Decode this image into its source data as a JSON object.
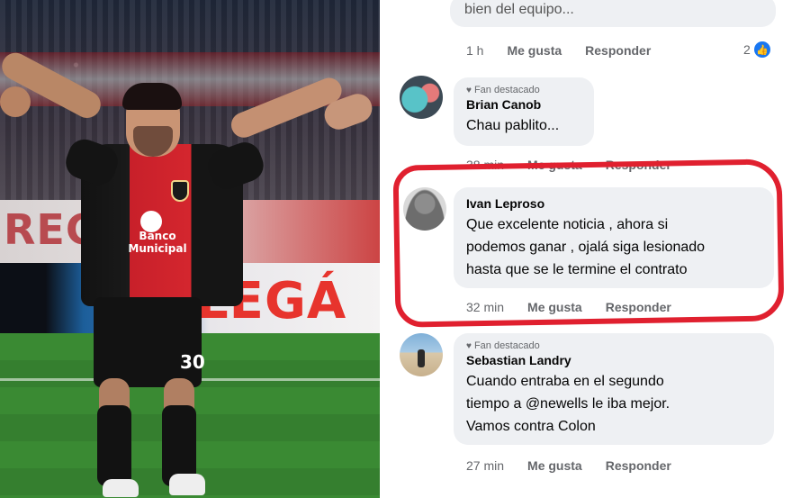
{
  "photo": {
    "banner_text": "RECHO",
    "adboard_text": "LEGÁ",
    "shirt_sponsor": "Banco Municipal",
    "shirt_number": "30"
  },
  "comments": [
    {
      "id": "top-partial",
      "text_partial": "bien del equipo...",
      "time": "1 h",
      "like_label": "Me gusta",
      "reply_label": "Responder",
      "reaction_count": "2"
    },
    {
      "id": "brian",
      "badge": "Fan destacado",
      "name": "Brian Canob",
      "text": "Chau pablito...",
      "time": "38 min",
      "like_label": "Me gusta",
      "reply_label": "Responder"
    },
    {
      "id": "ivan",
      "name": "Ivan Leproso",
      "text_lines": [
        "Que excelente noticia , ahora si",
        "podemos ganar , ojalá siga lesionado",
        "hasta que se le termine el contrato"
      ],
      "time": "32 min",
      "like_label": "Me gusta",
      "reply_label": "Responder"
    },
    {
      "id": "sebastian",
      "badge": "Fan destacado",
      "name": "Sebastian Landry",
      "text_lines": [
        "Cuando entraba en el segundo",
        "tiempo a @newells le iba mejor.",
        "Vamos contra Colon"
      ],
      "time": "27 min",
      "like_label": "Me gusta",
      "reply_label": "Responder"
    }
  ],
  "colors": {
    "highlight": "#e0202f",
    "bubble": "#eef0f3",
    "like_blue": "#1877f2"
  },
  "icons": [
    "heart-icon",
    "like-icon"
  ]
}
